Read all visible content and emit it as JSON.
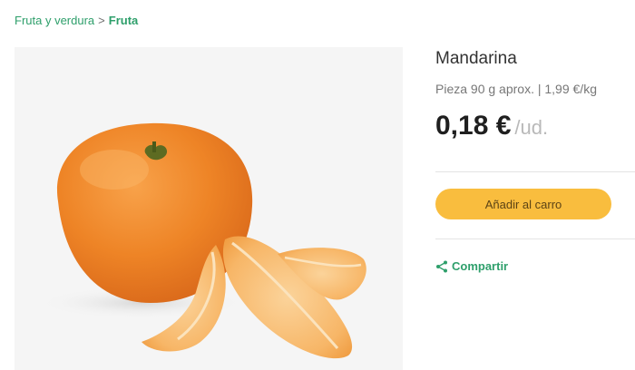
{
  "breadcrumb": {
    "parent": "Fruta y verdura",
    "separator": ">",
    "current": "Fruta"
  },
  "product": {
    "title": "Mandarina",
    "subtitle": "Pieza 90 g aprox. | 1,99 €/kg",
    "price": "0,18 €",
    "unit": "/ud."
  },
  "actions": {
    "add_to_cart": "Añadir al carro",
    "share": "Compartir"
  },
  "colors": {
    "accent_green": "#2e9f6b",
    "button_yellow": "#f9bd3e",
    "fruit_orange": "#f0862a"
  },
  "icons": {
    "share": "share-icon"
  }
}
